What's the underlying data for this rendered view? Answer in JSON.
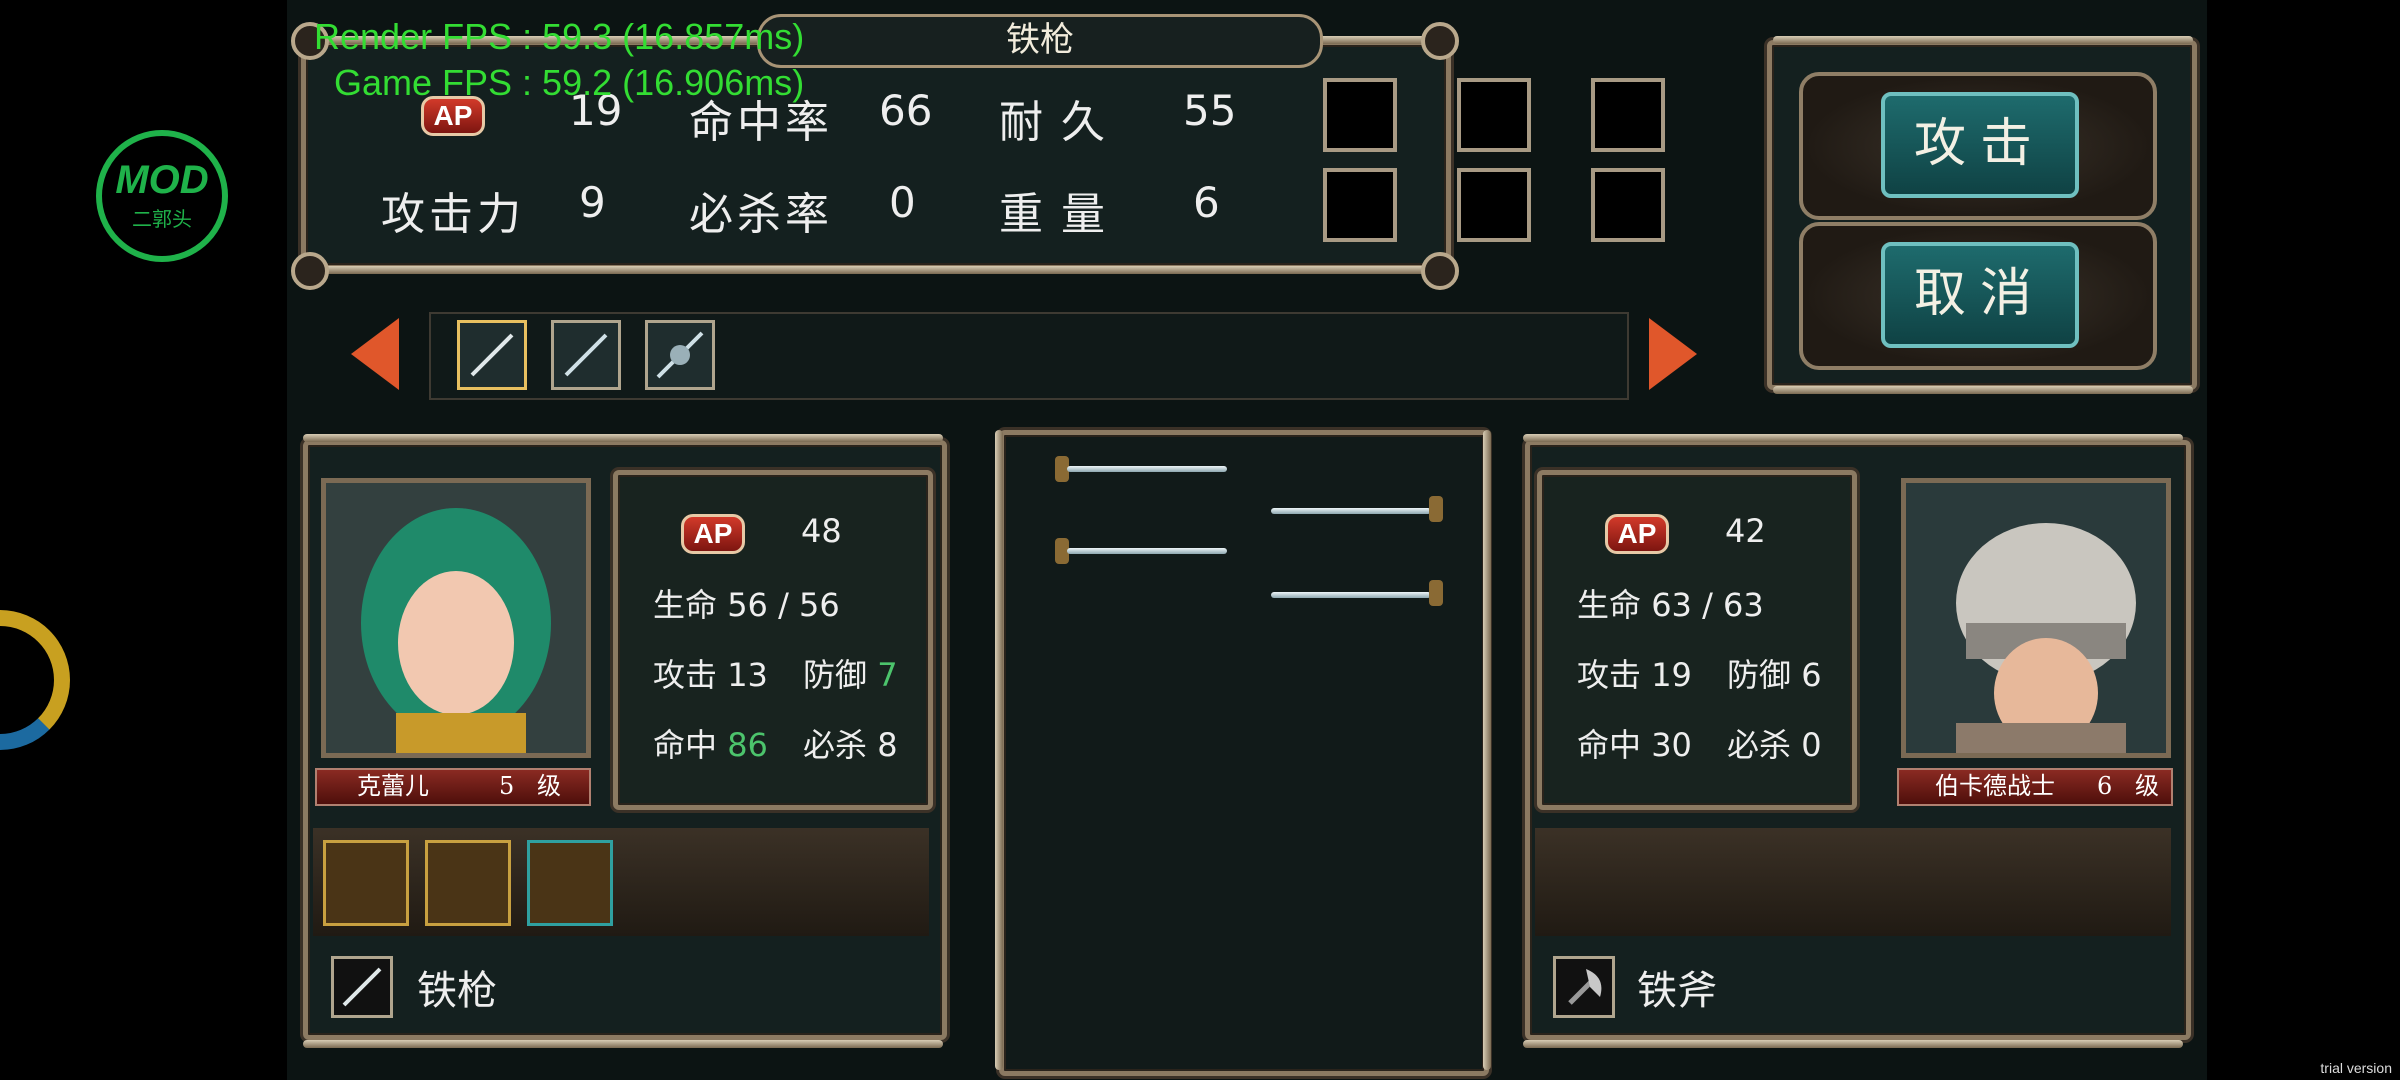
{
  "overlay": {
    "render_fps": "Render FPS : 59.3 (16.857ms)",
    "game_fps": "Game FPS : 59.2 (16.906ms)",
    "watermark": "trial version",
    "logo": {
      "text": "MOD",
      "sub": "二郭头"
    }
  },
  "weapon_title": "铁枪",
  "weapon_stats": {
    "ap_label": "AP",
    "ap_value": "19",
    "hit_label": "命中率",
    "hit_value": "66",
    "dur_label": "耐久",
    "dur_value": "55",
    "atk_label": "攻击力",
    "atk_value": "9",
    "crit_label": "必杀率",
    "crit_value": "0",
    "weight_label": "重量",
    "weight_value": "6"
  },
  "buttons": {
    "attack": "攻击",
    "cancel": "取消"
  },
  "weapon_selector": {
    "icons": [
      "spear-icon",
      "spear-icon",
      "halberd-icon"
    ],
    "selected_index": 0
  },
  "player": {
    "name": "克蕾儿",
    "level": "5",
    "level_unit": "级",
    "ap_label": "AP",
    "ap": "48",
    "hp_label": "生命",
    "hp": "56 / 56",
    "atk_label": "攻击",
    "atk": "13",
    "def_label": "防御",
    "def": "7",
    "hit_label": "命中",
    "hit": "86",
    "crit_label": "必杀",
    "crit": "8",
    "weapon": "铁枪",
    "items": [
      "sword-item-icon",
      "armor-item-icon",
      "warrior-item-icon"
    ]
  },
  "enemy": {
    "name": "伯卡德战士",
    "level": "6",
    "level_unit": "级",
    "ap_label": "AP",
    "ap": "42",
    "hp_label": "生命",
    "hp": "63 / 63",
    "atk_label": "攻击",
    "atk": "19",
    "def_label": "防御",
    "def": "6",
    "hit_label": "命中",
    "hit": "30",
    "crit_label": "必杀",
    "crit": "0",
    "weapon": "铁斧"
  },
  "colors": {
    "accent_red": "#e0572b",
    "highlight_green": "#4cc46c",
    "button_teal": "#1e6b6d"
  }
}
